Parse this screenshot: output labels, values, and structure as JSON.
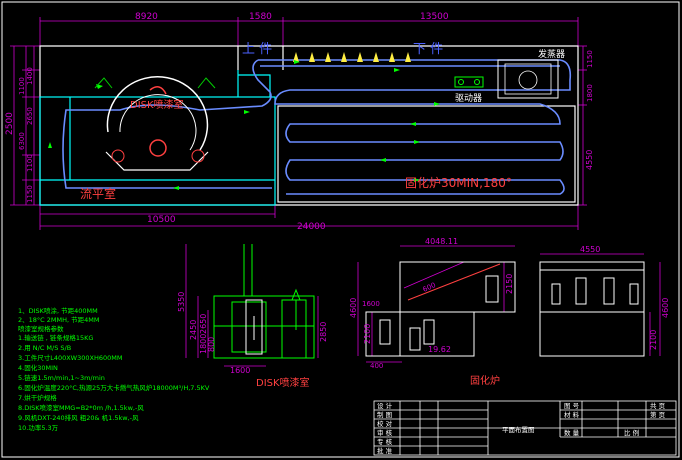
{
  "colors": {
    "background": "#000000",
    "building_outline": "#ffffff",
    "dimension": "#d000d0",
    "conveyor": "#00ffff",
    "guide_arrow": "#00ff00",
    "booth": "#ff4040",
    "notes": "#00ff00",
    "frame": "#ffffff",
    "label_blue": "#6464ff"
  },
  "plan": {
    "dims": {
      "top_left": "8920",
      "top_mid": "1580",
      "top_right": "13500",
      "bottom_left": "10500",
      "bottom_total": "24000",
      "left_a": "2500",
      "left_b": "6300",
      "left_c": "1400",
      "left_d": "1100",
      "left_e": "1150",
      "left_f": "1100",
      "left_g": "2650",
      "right_a": "1150",
      "right_b": "1800",
      "right_c": "4550"
    },
    "labels": {
      "loading": "上   件",
      "unloading": "下   件",
      "generator": "发蒸器",
      "driver": "驱动器",
      "disk_booth": "DISK喷漆室",
      "leveling": "流平室",
      "oven": "固化炉30MIN,180°"
    }
  },
  "section_disk": {
    "dims": [
      "5350",
      "2450",
      "2650",
      "1600",
      "800",
      "1800",
      "2850",
      "1600"
    ],
    "title": "DISK喷漆室"
  },
  "section_oven": {
    "dims": {
      "width": "4048.11",
      "height": "2150",
      "h_left": "4600",
      "h_a": "1600",
      "h_b": "2100",
      "slope_len": "600",
      "angle": "19.62",
      "base": "400"
    },
    "title": "固化炉"
  },
  "section_oven_end": {
    "dims": {
      "width": "4550",
      "h_right": "4600",
      "h_right_b": "2100"
    }
  },
  "notes": [
    "1、DISK喷涂, 节距400MM",
    "2、18°C 2MMH, 节距4MM",
    "   喷漆室规格参数",
    "1.输送链 , 链条规格15KG",
    "2.用  N/C  M/S   S/B",
    "3.工件尺寸L400XW300XH600MM",
    "4.固化30MIN",
    "5.链速1.5m/min,1~3m/min",
    "6.固化炉温度220°C,热源25万大卡燃气热风炉18000M³/H,7.5KV",
    "7.烘干炉规格",
    "8.DISK喷漆室MMG=B2*0m /h,1.5kw,-风",
    "9.风机DXT-240排风 粗20&   机1.5kw,-风",
    "10.功率5.3万"
  ],
  "title_block": {
    "rows_left": [
      "设 计",
      "制 图",
      "校 对",
      "审 核",
      "专 核",
      "批 准"
    ],
    "drawing_name": "平面布置图",
    "right_labels": [
      "图 号",
      "材 料",
      "数 量"
    ],
    "right_far": [
      "共 页",
      "第 页",
      "比 例"
    ]
  }
}
